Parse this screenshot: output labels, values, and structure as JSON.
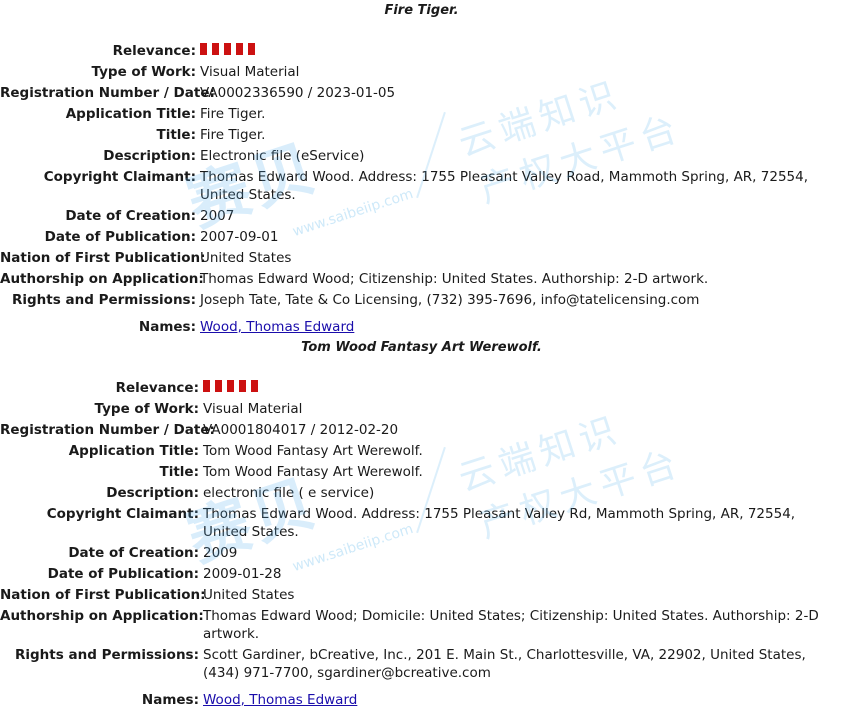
{
  "records": [
    {
      "title": "Fire Tiger.",
      "relevance": 5,
      "fields": [
        {
          "key": "relevance",
          "label": "Relevance:",
          "value": ""
        },
        {
          "key": "type_of_work",
          "label": "Type of Work:",
          "value": "Visual Material"
        },
        {
          "key": "registration",
          "label": "Registration Number / Date:",
          "value": "VA0002336590 / 2023-01-05"
        },
        {
          "key": "application_title",
          "label": "Application Title:",
          "value": "Fire Tiger."
        },
        {
          "key": "title",
          "label": "Title:",
          "value": "Fire Tiger."
        },
        {
          "key": "description",
          "label": "Description:",
          "value": "Electronic file (eService)"
        },
        {
          "key": "claimant",
          "label": "Copyright Claimant:",
          "value": "Thomas Edward Wood. Address: 1755 Pleasant Valley Road, Mammoth Spring, AR, 72554, United States."
        },
        {
          "key": "date_of_creation",
          "label": "Date of Creation:",
          "value": "2007"
        },
        {
          "key": "date_of_publication",
          "label": "Date of Publication:",
          "value": "2007-09-01"
        },
        {
          "key": "nation",
          "label": "Nation of First Publication:",
          "value": "United States"
        },
        {
          "key": "authorship",
          "label": "Authorship on Application:",
          "value": "Thomas Edward Wood; Citizenship: United States. Authorship: 2-D artwork."
        },
        {
          "key": "rights",
          "label": "Rights and Permissions:",
          "value": "Joseph Tate, Tate & Co Licensing, (732) 395-7696, info@tatelicensing.com"
        },
        {
          "key": "names",
          "label": "Names:",
          "value": "Wood, Thomas Edward"
        }
      ]
    },
    {
      "title": "Tom Wood Fantasy Art Werewolf.",
      "relevance": 5,
      "fields": [
        {
          "key": "relevance",
          "label": "Relevance:",
          "value": ""
        },
        {
          "key": "type_of_work",
          "label": "Type of Work:",
          "value": "Visual Material"
        },
        {
          "key": "registration",
          "label": "Registration Number / Date:",
          "value": "VA0001804017 / 2012-02-20"
        },
        {
          "key": "application_title",
          "label": "Application Title:",
          "value": "Tom Wood Fantasy Art Werewolf."
        },
        {
          "key": "title",
          "label": "Title:",
          "value": "Tom Wood Fantasy Art Werewolf."
        },
        {
          "key": "description",
          "label": "Description:",
          "value": "electronic file ( e service)"
        },
        {
          "key": "claimant",
          "label": "Copyright Claimant:",
          "value": "Thomas Edward Wood. Address: 1755 Pleasant Valley Rd, Mammoth Spring, AR, 72554, United States."
        },
        {
          "key": "date_of_creation",
          "label": "Date of Creation:",
          "value": "2009"
        },
        {
          "key": "date_of_publication",
          "label": "Date of Publication:",
          "value": "2009-01-28"
        },
        {
          "key": "nation",
          "label": "Nation of First Publication:",
          "value": "United States"
        },
        {
          "key": "authorship",
          "label": "Authorship on Application:",
          "value": "Thomas Edward Wood; Domicile: United States; Citizenship: United States. Authorship: 2-D artwork."
        },
        {
          "key": "rights",
          "label": "Rights and Permissions:",
          "value": "Scott Gardiner, bCreative, Inc., 201 E. Main St., Charlottesville, VA, 22902, United States, (434) 971-7700, sgardiner@bcreative.com"
        },
        {
          "key": "names",
          "label": "Names:",
          "value": "Wood, Thomas Edward"
        }
      ]
    }
  ],
  "colors": {
    "relevance_bar": "#cc1111",
    "link": "#1a0dab",
    "watermark": "#50afeb"
  },
  "watermark": {
    "logo_text": "赛贝",
    "line1": "云端知识",
    "line2": "产权大平台",
    "url": "www.saibeiip.com"
  }
}
